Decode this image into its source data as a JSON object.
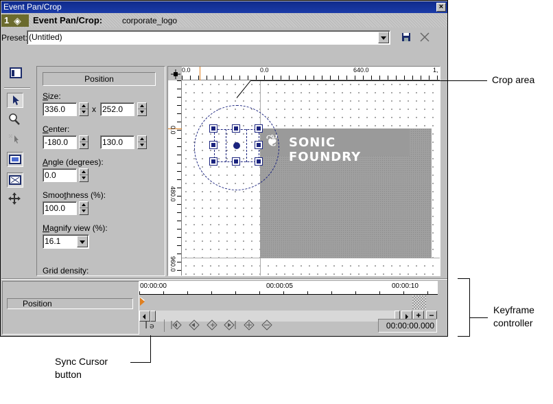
{
  "window": {
    "title": "Event Pan/Crop",
    "close_glyph": "×"
  },
  "event_header": {
    "index": "1",
    "label": "Event Pan/Crop:",
    "name": "corporate_logo"
  },
  "preset": {
    "label": "Preset:",
    "value": "(Untitled)"
  },
  "position_panel": {
    "header": "Position",
    "size_label": "Size:",
    "size_width": "336.0",
    "size_x": "x",
    "size_height": "252.0",
    "center_label": "Center:",
    "center_x": "-180.0",
    "center_y": "130.0",
    "angle_label": "Angle (degrees):",
    "angle_value": "0.0",
    "smoothness_label": "Smoothness (%):",
    "smoothness_value": "100.0",
    "magnify_label": "Magnify view (%):",
    "magnify_value": "16.1",
    "grid_density_label": "Grid density:"
  },
  "canvas": {
    "ruler_top": [
      "0.0",
      "0.0",
      "640.0",
      "1,"
    ],
    "ruler_left": [
      "0.0",
      "480.0",
      "960.0"
    ],
    "logo_text": "SONIC FOUNDRY"
  },
  "timeline": {
    "track_label": "Position",
    "ticks": [
      "00:00:00",
      "00:00:05",
      "00:00:10"
    ],
    "time_display": "00:00:00.000"
  },
  "callouts": {
    "crop_area": "Crop area",
    "keyframe_line1": "Keyframe",
    "keyframe_line2": "controller",
    "sync_line1": "Sync Cursor",
    "sync_line2": "button"
  },
  "icons": [
    "save-icon",
    "delete-preset-icon",
    "normal-edit-tool-icon",
    "zoom-tool-icon",
    "enable-snapping-icon",
    "lock-aspect-ratio-icon",
    "scale-about-center-icon",
    "move-freely-icon",
    "sync-cursor-icon",
    "first-keyframe-icon",
    "prev-keyframe-icon",
    "add-keyframe-icon",
    "last-keyframe-icon",
    "next-keyframe-icon",
    "delete-keyframe-icon"
  ]
}
